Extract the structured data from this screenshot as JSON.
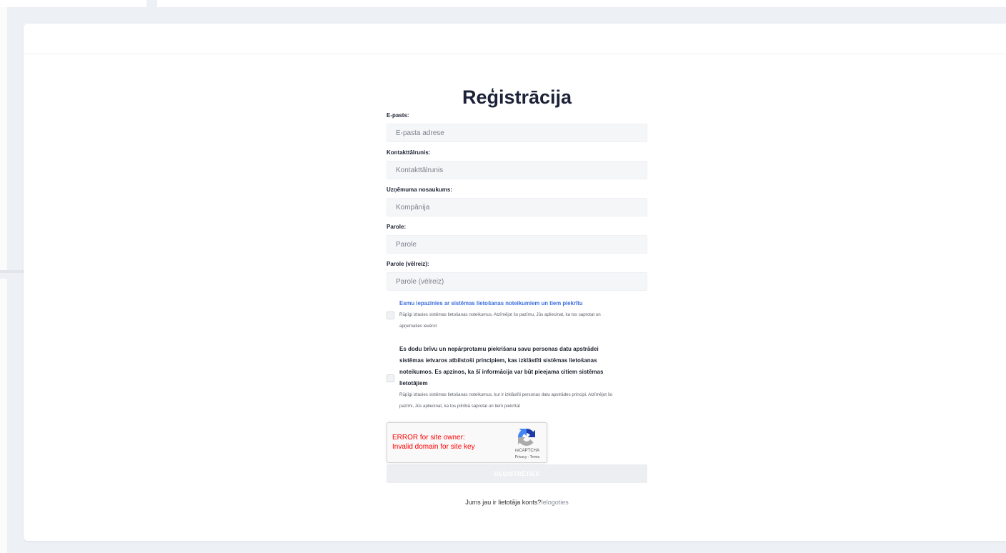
{
  "registration": {
    "title": "Reģistrācija",
    "fields": [
      {
        "label": "E-pasts:",
        "placeholder": "E-pasta adrese",
        "value": ""
      },
      {
        "label": "Kontakttālrunis:",
        "placeholder": "Kontakttālrunis",
        "value": ""
      },
      {
        "label": "Uzņēmuma nosaukums:",
        "placeholder": "Kompānija",
        "value": ""
      },
      {
        "label": "Parole:",
        "placeholder": "Parole",
        "value": ""
      },
      {
        "label": "Parole (vēlreiz):",
        "placeholder": "Parole (vēlreiz)",
        "value": ""
      }
    ],
    "terms_consent": {
      "checked": false,
      "title": "Esmu iepazinies ar sistēmas lietošanas noteikumiem un tiem piekrītu",
      "description_lines": [
        "Rūpīgi izlasies sistēmas lietošanas noteikumus. Atzīmējot šo pazīmu, Jūs apliecinat, ka tos saprotat un",
        "apņematies ievērot"
      ]
    },
    "data_consent": {
      "checked": false,
      "text_lines": [
        "Es dodu brīvu un nepārprotamu piekrišanu savu personas datu apstrādei",
        "sistēmas ietvaros atbilstoši principiem, kas izklāstīti sistēmas lietošanas",
        "noteikumos. Es apzinos, ka šī informācija var būt pieejama citiem sistēmas",
        "lietotājiem"
      ],
      "description_lines": [
        "Rūpīgi izlasies sistēmas lietošanas noteikumus, kur ir izklāstīti personas datu apstrādes principi. Atzīmējot šo",
        "pazīmi, Jūs apliecinat, ka tos pilnībā saprotat un tiem piekrītat"
      ]
    },
    "recaptcha": {
      "error_lines": [
        "ERROR for site owner:",
        "Invalid domain for site key"
      ],
      "brand": "reCAPTCHA",
      "privacy_link": "Privacy",
      "link_separator": " - ",
      "terms_link": "Terms"
    },
    "submit_label": "REĢISTRĒTIES",
    "login_prompt": "Jums jau ir lietotāja konts?",
    "login_link": "Ielogoties"
  },
  "icons": {
    "recaptcha": "recaptcha-logo-icon"
  },
  "colors": {
    "title": "#1c2237",
    "accent": "#3b6fdc",
    "error": "#ff0000",
    "button_bg": "#eceef1",
    "input_bg": "#f5f6f8",
    "link_muted": "#8a8f99"
  }
}
